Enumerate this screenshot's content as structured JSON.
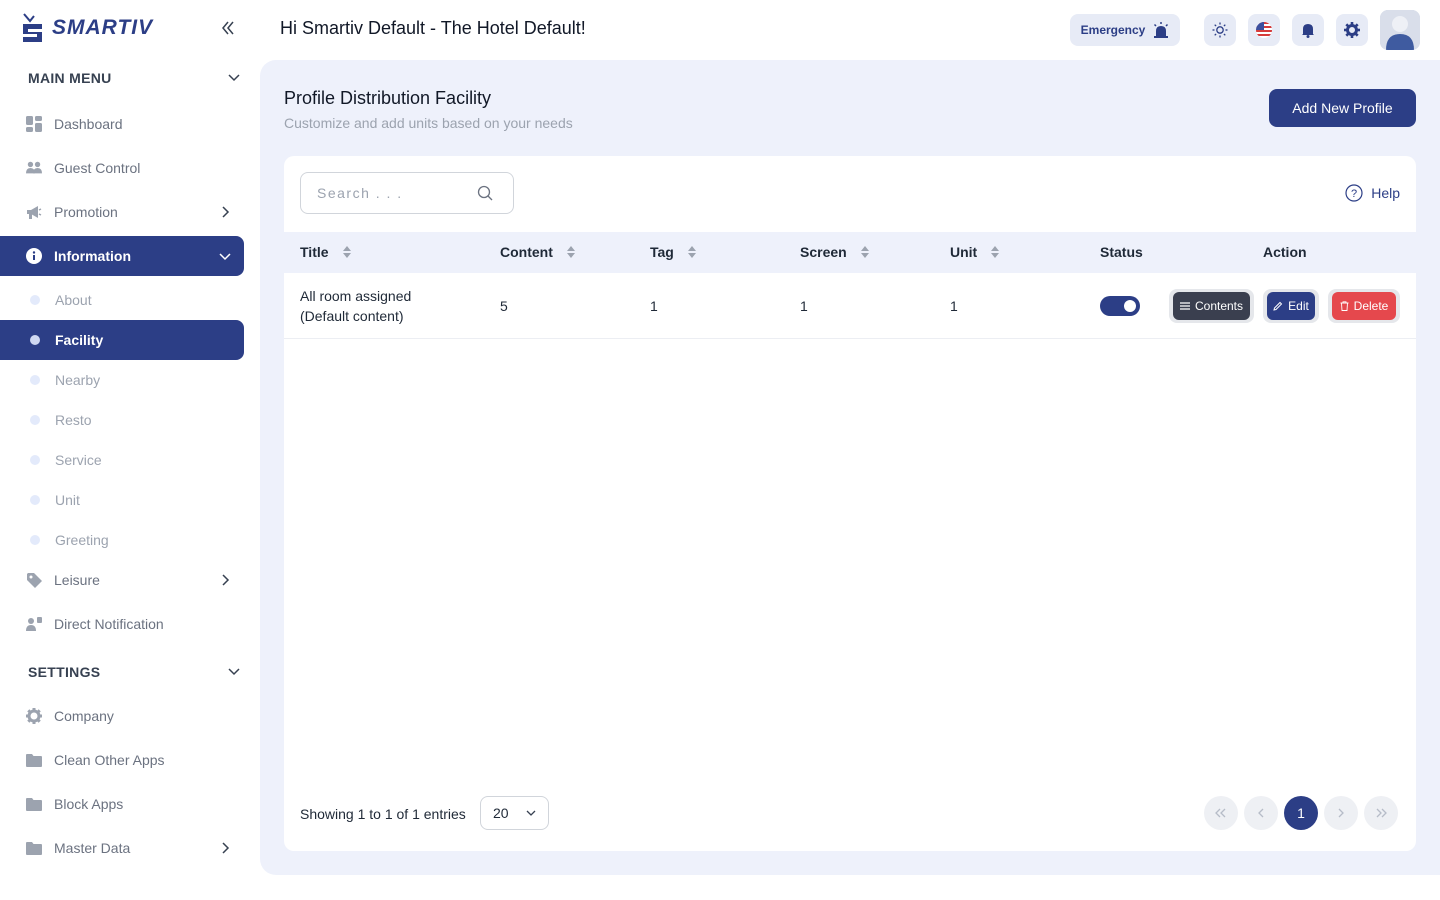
{
  "app": {
    "logo_text": "SMARTIV"
  },
  "sidebar": {
    "main_menu": "MAIN MENU",
    "settings": "SETTINGS",
    "items": [
      {
        "label": "Dashboard"
      },
      {
        "label": "Guest Control"
      },
      {
        "label": "Promotion"
      },
      {
        "label": "Information"
      },
      {
        "label": "Leisure"
      },
      {
        "label": "Direct Notification"
      }
    ],
    "information_sub": [
      {
        "label": "About"
      },
      {
        "label": "Facility"
      },
      {
        "label": "Nearby"
      },
      {
        "label": "Resto"
      },
      {
        "label": "Service"
      },
      {
        "label": "Unit"
      },
      {
        "label": "Greeting"
      }
    ],
    "settings_items": [
      {
        "label": "Company"
      },
      {
        "label": "Clean Other Apps"
      },
      {
        "label": "Block Apps"
      },
      {
        "label": "Master Data"
      }
    ]
  },
  "header": {
    "greeting": "Hi Smartiv Default - The Hotel Default!",
    "emergency_label": "Emergency"
  },
  "page": {
    "title": "Profile Distribution Facility",
    "subtitle": "Customize and add units based on your needs",
    "add_button": "Add New Profile"
  },
  "search": {
    "placeholder": "Search . . ."
  },
  "help_label": "Help",
  "table": {
    "columns": [
      "Title",
      "Content",
      "Tag",
      "Screen",
      "Unit",
      "Status",
      "Action"
    ],
    "rows": [
      {
        "title_line1": "All room assigned",
        "title_line2": "(Default content)",
        "content": "5",
        "tag": "1",
        "screen": "1",
        "unit": "1",
        "status_on": true
      }
    ],
    "actions": {
      "contents": "Contents",
      "edit": "Edit",
      "delete": "Delete"
    }
  },
  "footer": {
    "showing": "Showing 1 to 1 of 1 entries",
    "page_size": "20",
    "current_page": "1"
  },
  "colors": {
    "primary": "#2c3e86",
    "panel": "#eef1fb",
    "danger": "#e5484d",
    "dark": "#3a3f4f"
  }
}
